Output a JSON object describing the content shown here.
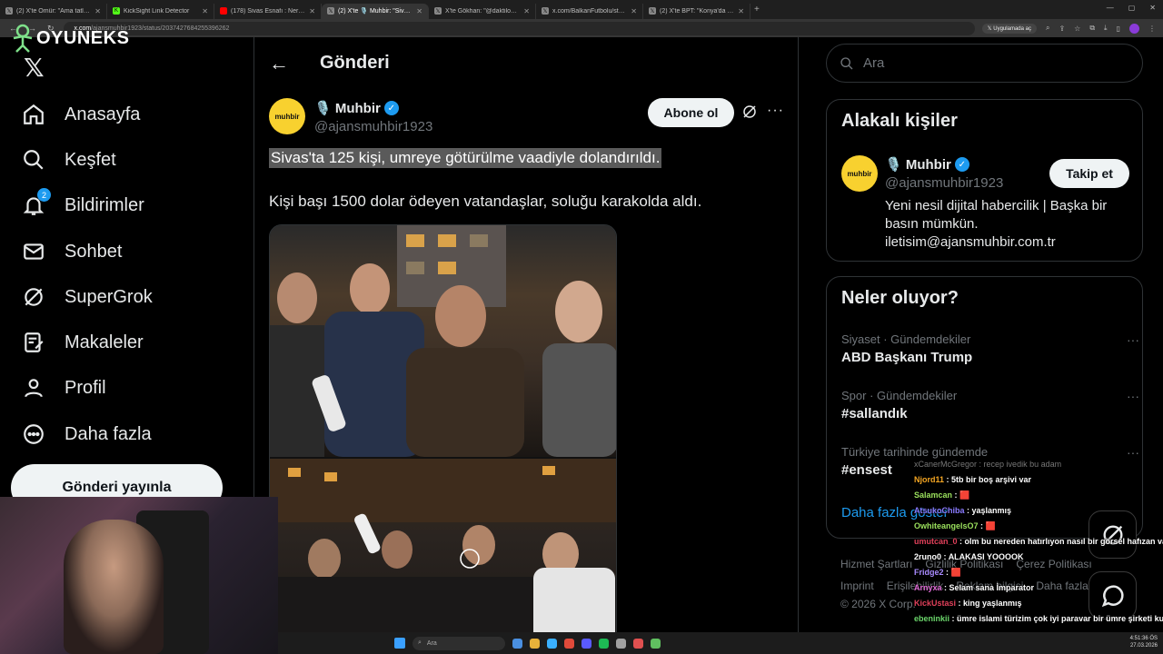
{
  "browser": {
    "tabs": [
      {
        "title": "(2) X'te Ömür: \"Ama tatlım en y",
        "favicon": "x-icon",
        "active": false
      },
      {
        "title": "KickSight Link Detector",
        "favicon": "k-icon",
        "active": false
      },
      {
        "title": "(178) Sivas Esnafı : Nereye Sıça",
        "favicon": "youtube-icon",
        "active": false
      },
      {
        "title": "(2) X'te 🎙️ Muhbir: \"Sivas'ta 1:",
        "favicon": "x-icon",
        "active": true
      },
      {
        "title": "X'te Gökhan: \"@daktilock Aracı",
        "favicon": "x-icon",
        "active": false
      },
      {
        "title": "x.com/BalkanFutbolu/status/20",
        "favicon": "x-icon",
        "active": false
      },
      {
        "title": "(2) X'te BPT: \"Konya'da motor g",
        "favicon": "x-icon",
        "active": false
      }
    ],
    "url_domain": "x.com",
    "url_path": "/ajansmuhbir1923/status/2037427684255396262",
    "open_in_app_label": "Uygulamada aç"
  },
  "overlay": {
    "brand_name": "OYUNEKS"
  },
  "sidebar": {
    "items": [
      {
        "label": "Anasayfa",
        "icon": "home-icon"
      },
      {
        "label": "Keşfet",
        "icon": "search-icon"
      },
      {
        "label": "Bildirimler",
        "icon": "bell-icon",
        "badge": "2"
      },
      {
        "label": "Sohbet",
        "icon": "mail-icon"
      },
      {
        "label": "SuperGrok",
        "icon": "grok-icon"
      },
      {
        "label": "Makaleler",
        "icon": "article-icon"
      },
      {
        "label": "Profil",
        "icon": "person-icon"
      },
      {
        "label": "Daha fazla",
        "icon": "more-circle-icon"
      }
    ],
    "post_button": "Gönderi yayınla"
  },
  "main": {
    "header_title": "Gönderi",
    "post": {
      "avatar_text": "muhbir",
      "author_name": "🎙️ Muhbir",
      "author_handle": "@ajansmuhbir1923",
      "subscribe_label": "Abone ol",
      "headline": "Sivas'ta 125 kişi, umreye götürülme vaadiyle dolandırıldı.",
      "body": "Kişi başı 1500 dolar ödeyen vatandaşlar, soluğu karakolda aldı."
    }
  },
  "right": {
    "search_placeholder": "Ara",
    "related": {
      "title": "Alakalı kişiler",
      "avatar_text": "muhbir",
      "name": "🎙️ Muhbir",
      "handle": "@ajansmuhbir1923",
      "follow_label": "Takip et",
      "bio": "Yeni nesil dijital habercilik | Başka bir basın mümkün. iletisim@ajansmuhbir.com.tr"
    },
    "trends": {
      "title": "Neler oluyor?",
      "items": [
        {
          "category": "Siyaset · Gündemdekiler",
          "name": "ABD Başkanı Trump"
        },
        {
          "category": "Spor · Gündemdekiler",
          "name": "#sallandık"
        },
        {
          "category": "Türkiye tarihinde gündemde",
          "name": "#ensest"
        }
      ],
      "show_more": "Daha fazla göster"
    },
    "footer": {
      "row1": [
        "Hizmet Şartları",
        "Gizlilik Politikası",
        "Çerez Politikası"
      ],
      "row2": [
        "Imprint",
        "Erişilebilirlik",
        "Reklam bilgisi",
        "Daha fazla"
      ],
      "copyright": "© 2026 X Corp."
    }
  },
  "chat": [
    {
      "user": "xCanerMcGregor",
      "text": "recep ivedik bu adam",
      "color": "#777777",
      "faded": true
    },
    {
      "user": "Njord11",
      "text": "5tb bir boş arşivi var",
      "color": "#f5a623"
    },
    {
      "user": "Salamcan",
      "text": "🟥",
      "color": "#9be15d"
    },
    {
      "user": "AtsukoChiba",
      "text": "yaşlanmış",
      "color": "#8a7bff"
    },
    {
      "user": "OwhiteangelsO7",
      "text": "🟥",
      "color": "#9be15d"
    },
    {
      "user": "umutcan_0",
      "text": "olm bu nereden hatırlıyon nasıl bir görsel hafızan var",
      "color": "#e0405a"
    },
    {
      "user": "2runo0",
      "text": "ALAKASI YOOOOK",
      "color": "#ffffff"
    },
    {
      "user": "Fridge2",
      "text": "🟥",
      "color": "#a98bff"
    },
    {
      "user": "Arnyxa",
      "text": "Selam sana İmparator",
      "color": "#e06bd6"
    },
    {
      "user": "KickUstasi",
      "text": "king yaşlanmış",
      "color": "#e0405a"
    },
    {
      "user": "ebeninkii",
      "text": "ümre islami türizim çok iyi paravar bir ümre şirketi kursak parayı kırarız",
      "color": "#6bd66b"
    }
  ],
  "taskbar": {
    "search_label": "Ara",
    "time": "4:51:36 ÖS",
    "date": "27.03.2026"
  }
}
